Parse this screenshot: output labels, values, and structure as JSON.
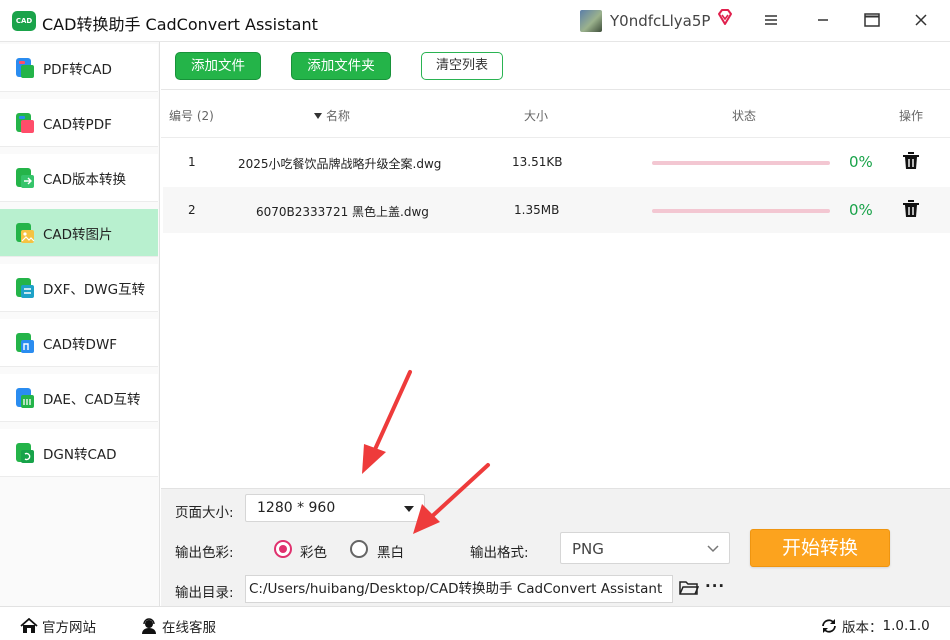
{
  "app": {
    "logo_text": "CAD",
    "title": "CAD转换助手 CadConvert Assistant",
    "username": "Y0ndfcLlya5P"
  },
  "sidebar": {
    "items": [
      {
        "label": "PDF转CAD",
        "active": false
      },
      {
        "label": "CAD转PDF",
        "active": false
      },
      {
        "label": "CAD版本转换",
        "active": false
      },
      {
        "label": "CAD转图片",
        "active": true
      },
      {
        "label": "DXF、DWG互转",
        "active": false
      },
      {
        "label": "CAD转DWF",
        "active": false
      },
      {
        "label": "DAE、CAD互转",
        "active": false
      },
      {
        "label": "DGN转CAD",
        "active": false
      }
    ]
  },
  "toolbar": {
    "add_file": "添加文件",
    "add_folder": "添加文件夹",
    "clear_list": "清空列表"
  },
  "table": {
    "headers": {
      "index": "编号 (2)",
      "name": "名称",
      "size": "大小",
      "status": "状态",
      "action": "操作"
    },
    "rows": [
      {
        "index": "1",
        "name": "2025小吃餐饮品牌战略升级全案.dwg",
        "size": "13.51KB",
        "progress": 0,
        "percent": "0%"
      },
      {
        "index": "2",
        "name": "6070B2333721 黑色上盖.dwg",
        "size": "1.35MB",
        "progress": 0,
        "percent": "0%"
      }
    ]
  },
  "settings": {
    "page_size_label": "页面大小:",
    "page_size_value": "1280 * 960",
    "color_label": "输出色彩:",
    "color_option_color": "彩色",
    "color_option_bw": "黑白",
    "format_label": "输出格式:",
    "format_value": "PNG",
    "output_dir_label": "输出目录:",
    "output_dir_value": "C:/Users/huibang/Desktop/CAD转换助手 CadConvert Assistant",
    "more_label": "···",
    "start_button": "开始转换"
  },
  "statusbar": {
    "website": "官方网站",
    "support": "在线客服",
    "version_label": "版本：",
    "version_value": "1.0.1.0"
  },
  "colors": {
    "accent_green": "#24b449",
    "active_nav": "#b8f0cf",
    "start_orange": "#fca31e",
    "radio_checked": "#e0316e",
    "arrow_red": "#ee3b3b"
  }
}
